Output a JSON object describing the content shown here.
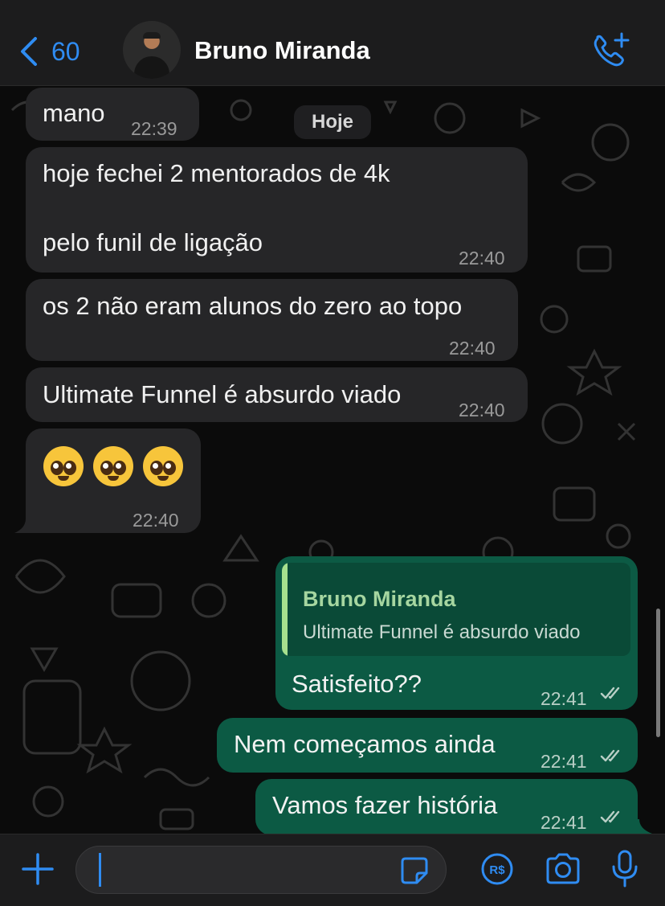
{
  "header": {
    "back_count": "60",
    "contact_name": "Bruno Miranda",
    "icons": {
      "back": "chevron-left-icon",
      "call": "phone-add-icon"
    },
    "accent_color": "#2f8cf2"
  },
  "chat": {
    "day_separator": "Hoje",
    "messages": [
      {
        "direction": "incoming",
        "text": "mano",
        "time": "22:39"
      },
      {
        "direction": "incoming",
        "lines": [
          "hoje fechei 2 mentorados de 4k",
          "",
          "pelo funil de ligação"
        ],
        "time": "22:40"
      },
      {
        "direction": "incoming",
        "text": "os 2 não eram alunos do zero ao topo",
        "time": "22:40"
      },
      {
        "direction": "incoming",
        "text": "Ultimate Funnel é absurdo viado",
        "time": "22:40"
      },
      {
        "direction": "incoming",
        "emoji": [
          "pleading-face",
          "pleading-face",
          "pleading-face"
        ],
        "time": "22:40"
      },
      {
        "direction": "outgoing",
        "quote": {
          "name": "Bruno Miranda",
          "text": "Ultimate Funnel é absurdo viado"
        },
        "text": "Satisfeito??",
        "time": "22:41",
        "status": "read"
      },
      {
        "direction": "outgoing",
        "text": "Nem começamos ainda",
        "time": "22:41",
        "status": "read"
      },
      {
        "direction": "outgoing",
        "text": "Vamos fazer história",
        "time": "22:41",
        "status": "read"
      }
    ]
  },
  "input_bar": {
    "message_value": "",
    "icons": [
      "plus-icon",
      "sticker-icon",
      "payment-icon",
      "camera-icon",
      "microphone-icon"
    ]
  },
  "colors": {
    "incoming_bubble": "#262628",
    "outgoing_bubble": "#0c5a44",
    "quote_bar": "#a6e08e"
  }
}
